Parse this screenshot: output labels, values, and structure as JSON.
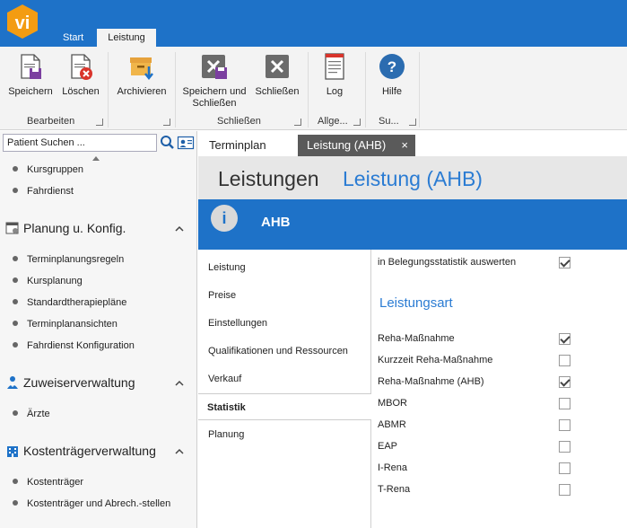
{
  "app": {
    "logo_text": "vi"
  },
  "ribbon_tabs": [
    {
      "label": "Start"
    },
    {
      "label": "Leistung"
    }
  ],
  "ribbon": {
    "buttons": {
      "speichern": "Speichern",
      "loeschen": "Löschen",
      "archivieren": "Archivieren",
      "speichern_schliessen_1": "Speichern und",
      "speichern_schliessen_2": "Schließen",
      "schliessen": "Schließen",
      "log": "Log",
      "hilfe": "Hilfe"
    },
    "groups": {
      "bearbeiten": "Bearbeiten",
      "schliessen": "Schließen",
      "allgemein": "Allge...",
      "support": "Su..."
    }
  },
  "sidebar": {
    "search_value": "Patient Suchen ...",
    "items_top": [
      "Kursgruppen",
      "Fahrdienst"
    ],
    "sections": [
      {
        "title": "Planung u. Konfig.",
        "items": [
          "Terminplanungsregeln",
          "Kursplanung",
          "Standardtherapiepläne",
          "Terminplanansichten",
          "Fahrdienst Konfiguration"
        ]
      },
      {
        "title": "Zuweiserverwaltung",
        "items": [
          "Ärzte"
        ]
      },
      {
        "title": "Kostenträgerverwaltung",
        "items": [
          "Kostenträger",
          "Kostenträger und Abrech.-stellen"
        ]
      }
    ]
  },
  "doc_tabs": [
    {
      "label": "Terminplan"
    },
    {
      "label": "Leistung (AHB)",
      "close": "×"
    }
  ],
  "header": {
    "title": "Leistungen",
    "subtitle": "Leistung (AHB)"
  },
  "infobar": {
    "icon": "i",
    "title": "AHB"
  },
  "subnav": [
    "Leistung",
    "Preise",
    "Einstellungen",
    "Qualifikationen und Ressourcen",
    "Verkauf",
    "Statistik",
    "Planung"
  ],
  "content": {
    "belegung_label": "in Belegungsstatistik auswerten",
    "belegung_checked": true,
    "section_title": "Leistungsart",
    "options": [
      {
        "label": "Reha-Maßnahme",
        "checked": true
      },
      {
        "label": "Kurzzeit Reha-Maßnahme",
        "checked": false
      },
      {
        "label": "Reha-Maßnahme (AHB)",
        "checked": true
      },
      {
        "label": "MBOR",
        "checked": false
      },
      {
        "label": "ABMR",
        "checked": false
      },
      {
        "label": "EAP",
        "checked": false
      },
      {
        "label": "I-Rena",
        "checked": false
      },
      {
        "label": "T-Rena",
        "checked": false
      }
    ]
  },
  "colors": {
    "accent": "#1e72c8",
    "logo": "#f39c12",
    "title_blue": "#2b7cd3"
  }
}
